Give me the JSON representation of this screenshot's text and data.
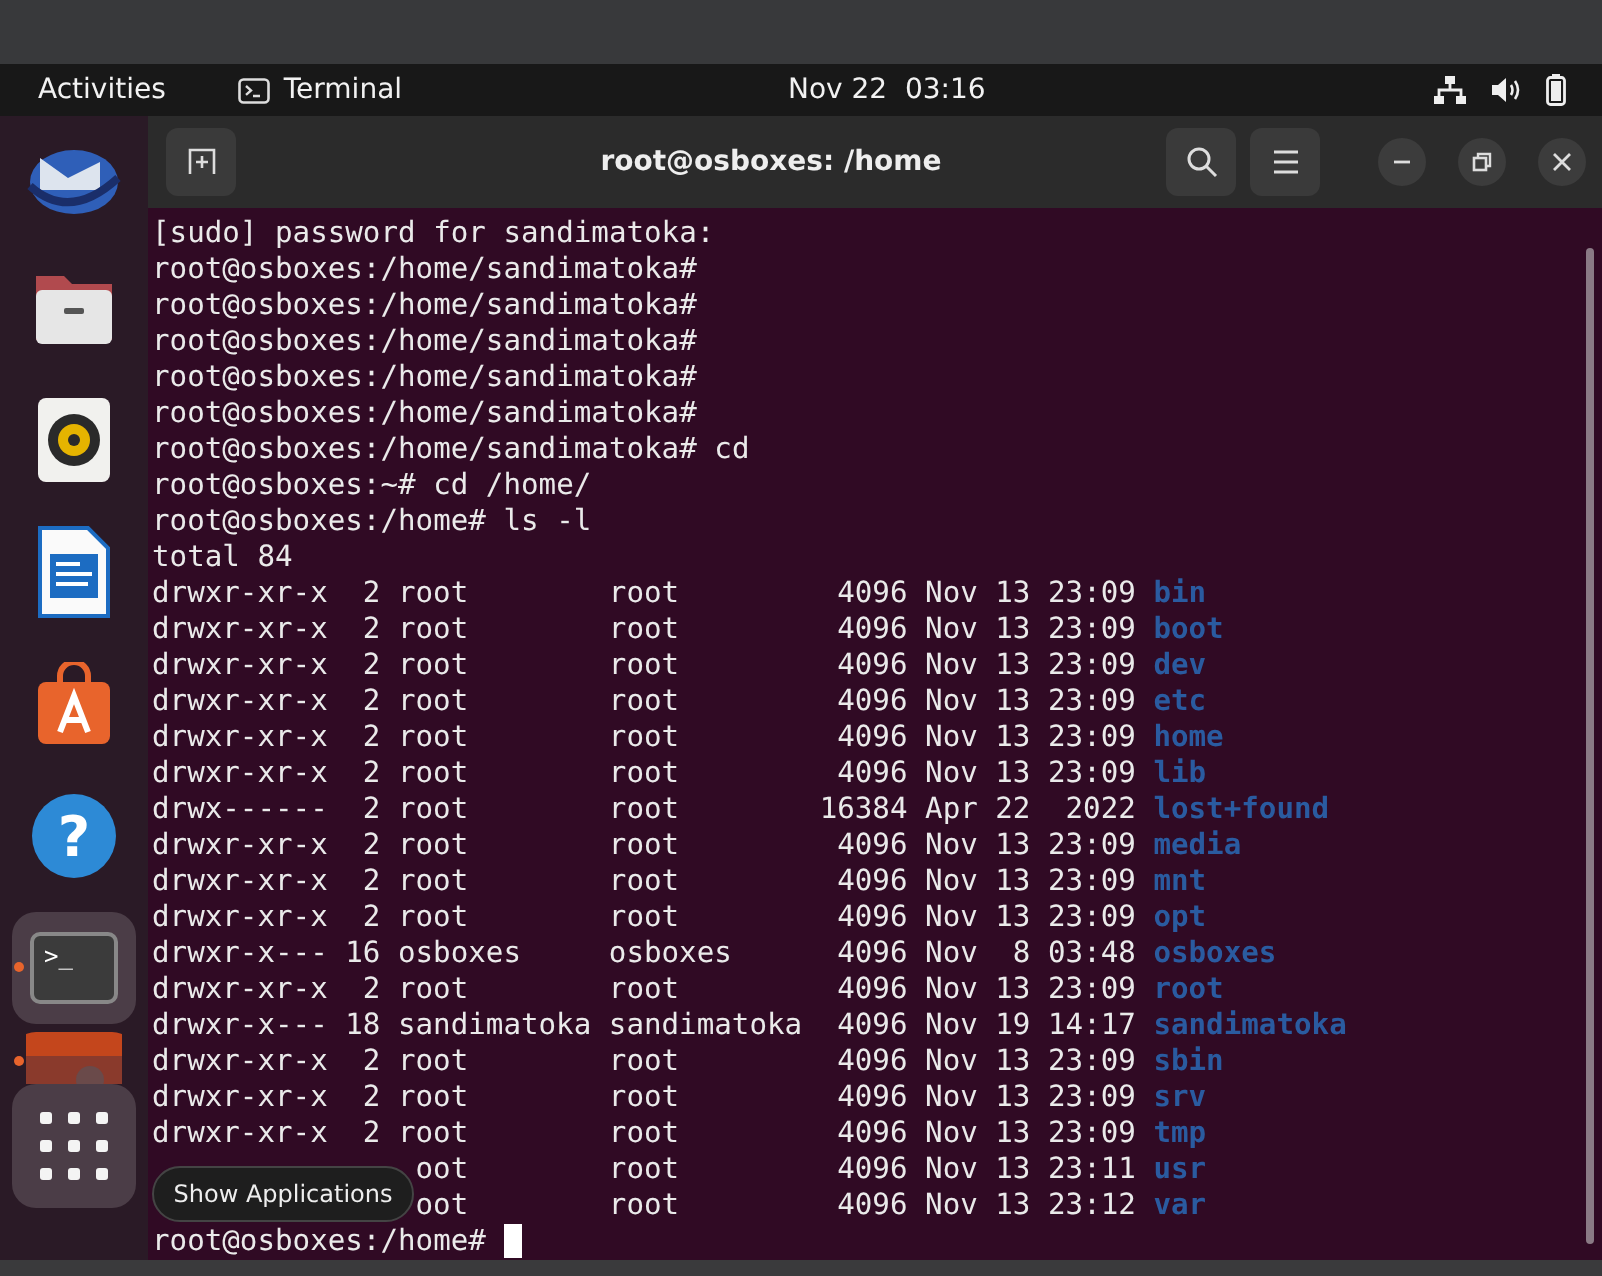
{
  "top_bar": {
    "activities": "Activities",
    "app_name": "Terminal",
    "clock": "Nov 22  03:16"
  },
  "dock": [
    {
      "kind": "mail",
      "selected": false,
      "running": false
    },
    {
      "kind": "files",
      "selected": false,
      "running": false
    },
    {
      "kind": "music",
      "selected": false,
      "running": false
    },
    {
      "kind": "writer",
      "selected": false,
      "running": false
    },
    {
      "kind": "store",
      "selected": false,
      "running": false
    },
    {
      "kind": "help",
      "glyph": "?",
      "selected": false,
      "running": false
    },
    {
      "kind": "terminal",
      "glyph": ">_",
      "selected": true,
      "running": true
    },
    {
      "kind": "video",
      "selected": false,
      "running": true
    },
    {
      "kind": "apps",
      "selected": true,
      "running": false
    }
  ],
  "tooltip": "Show Applications",
  "window": {
    "title": "root@osboxes: /home"
  },
  "lines": [
    {
      "kind": "text",
      "text": "[sudo] password for sandimatoka:"
    },
    {
      "kind": "text",
      "text": "root@osboxes:/home/sandimatoka#"
    },
    {
      "kind": "text",
      "text": "root@osboxes:/home/sandimatoka#"
    },
    {
      "kind": "text",
      "text": "root@osboxes:/home/sandimatoka#"
    },
    {
      "kind": "text",
      "text": "root@osboxes:/home/sandimatoka#"
    },
    {
      "kind": "text",
      "text": "root@osboxes:/home/sandimatoka#"
    },
    {
      "kind": "text",
      "text": "root@osboxes:/home/sandimatoka# cd"
    },
    {
      "kind": "text",
      "text": "root@osboxes:~# cd /home/"
    },
    {
      "kind": "text",
      "text": "root@osboxes:/home# ls -l"
    },
    {
      "kind": "text",
      "text": "total 84"
    },
    {
      "kind": "entry",
      "perms": "drwxr-xr-x",
      "links": "2",
      "owner": "root",
      "group": "root",
      "size": "4096",
      "month": "Nov",
      "day": "13",
      "time": "23:09",
      "name": "bin"
    },
    {
      "kind": "entry",
      "perms": "drwxr-xr-x",
      "links": "2",
      "owner": "root",
      "group": "root",
      "size": "4096",
      "month": "Nov",
      "day": "13",
      "time": "23:09",
      "name": "boot"
    },
    {
      "kind": "entry",
      "perms": "drwxr-xr-x",
      "links": "2",
      "owner": "root",
      "group": "root",
      "size": "4096",
      "month": "Nov",
      "day": "13",
      "time": "23:09",
      "name": "dev"
    },
    {
      "kind": "entry",
      "perms": "drwxr-xr-x",
      "links": "2",
      "owner": "root",
      "group": "root",
      "size": "4096",
      "month": "Nov",
      "day": "13",
      "time": "23:09",
      "name": "etc"
    },
    {
      "kind": "entry",
      "perms": "drwxr-xr-x",
      "links": "2",
      "owner": "root",
      "group": "root",
      "size": "4096",
      "month": "Nov",
      "day": "13",
      "time": "23:09",
      "name": "home"
    },
    {
      "kind": "entry",
      "perms": "drwxr-xr-x",
      "links": "2",
      "owner": "root",
      "group": "root",
      "size": "4096",
      "month": "Nov",
      "day": "13",
      "time": "23:09",
      "name": "lib"
    },
    {
      "kind": "entry",
      "perms": "drwx------",
      "links": "2",
      "owner": "root",
      "group": "root",
      "size": "16384",
      "month": "Apr",
      "day": "22",
      "time": "2022",
      "name": "lost+found"
    },
    {
      "kind": "entry",
      "perms": "drwxr-xr-x",
      "links": "2",
      "owner": "root",
      "group": "root",
      "size": "4096",
      "month": "Nov",
      "day": "13",
      "time": "23:09",
      "name": "media"
    },
    {
      "kind": "entry",
      "perms": "drwxr-xr-x",
      "links": "2",
      "owner": "root",
      "group": "root",
      "size": "4096",
      "month": "Nov",
      "day": "13",
      "time": "23:09",
      "name": "mnt"
    },
    {
      "kind": "entry",
      "perms": "drwxr-xr-x",
      "links": "2",
      "owner": "root",
      "group": "root",
      "size": "4096",
      "month": "Nov",
      "day": "13",
      "time": "23:09",
      "name": "opt"
    },
    {
      "kind": "entry",
      "perms": "drwxr-x---",
      "links": "16",
      "owner": "osboxes",
      "group": "osboxes",
      "size": "4096",
      "month": "Nov",
      "day": "8",
      "time": "03:48",
      "name": "osboxes"
    },
    {
      "kind": "entry",
      "perms": "drwxr-xr-x",
      "links": "2",
      "owner": "root",
      "group": "root",
      "size": "4096",
      "month": "Nov",
      "day": "13",
      "time": "23:09",
      "name": "root"
    },
    {
      "kind": "entry",
      "perms": "drwxr-x---",
      "links": "18",
      "owner": "sandimatoka",
      "group": "sandimatoka",
      "size": "4096",
      "month": "Nov",
      "day": "19",
      "time": "14:17",
      "name": "sandimatoka"
    },
    {
      "kind": "entry",
      "perms": "drwxr-xr-x",
      "links": "2",
      "owner": "root",
      "group": "root",
      "size": "4096",
      "month": "Nov",
      "day": "13",
      "time": "23:09",
      "name": "sbin"
    },
    {
      "kind": "entry",
      "perms": "drwxr-xr-x",
      "links": "2",
      "owner": "root",
      "group": "root",
      "size": "4096",
      "month": "Nov",
      "day": "13",
      "time": "23:09",
      "name": "srv"
    },
    {
      "kind": "entry",
      "perms": "drwxr-xr-x",
      "links": "2",
      "owner": "root",
      "group": "root",
      "size": "4096",
      "month": "Nov",
      "day": "13",
      "time": "23:09",
      "name": "tmp"
    },
    {
      "kind": "covered",
      "owner": "oot",
      "group": "root",
      "size": "4096",
      "month": "Nov",
      "day": "13",
      "time": "23:11",
      "name": "usr"
    },
    {
      "kind": "covered",
      "owner": "oot",
      "group": "root",
      "size": "4096",
      "month": "Nov",
      "day": "13",
      "time": "23:12",
      "name": "var"
    },
    {
      "kind": "prompt",
      "text": "root@osboxes:/home#",
      "cursor": true
    }
  ]
}
